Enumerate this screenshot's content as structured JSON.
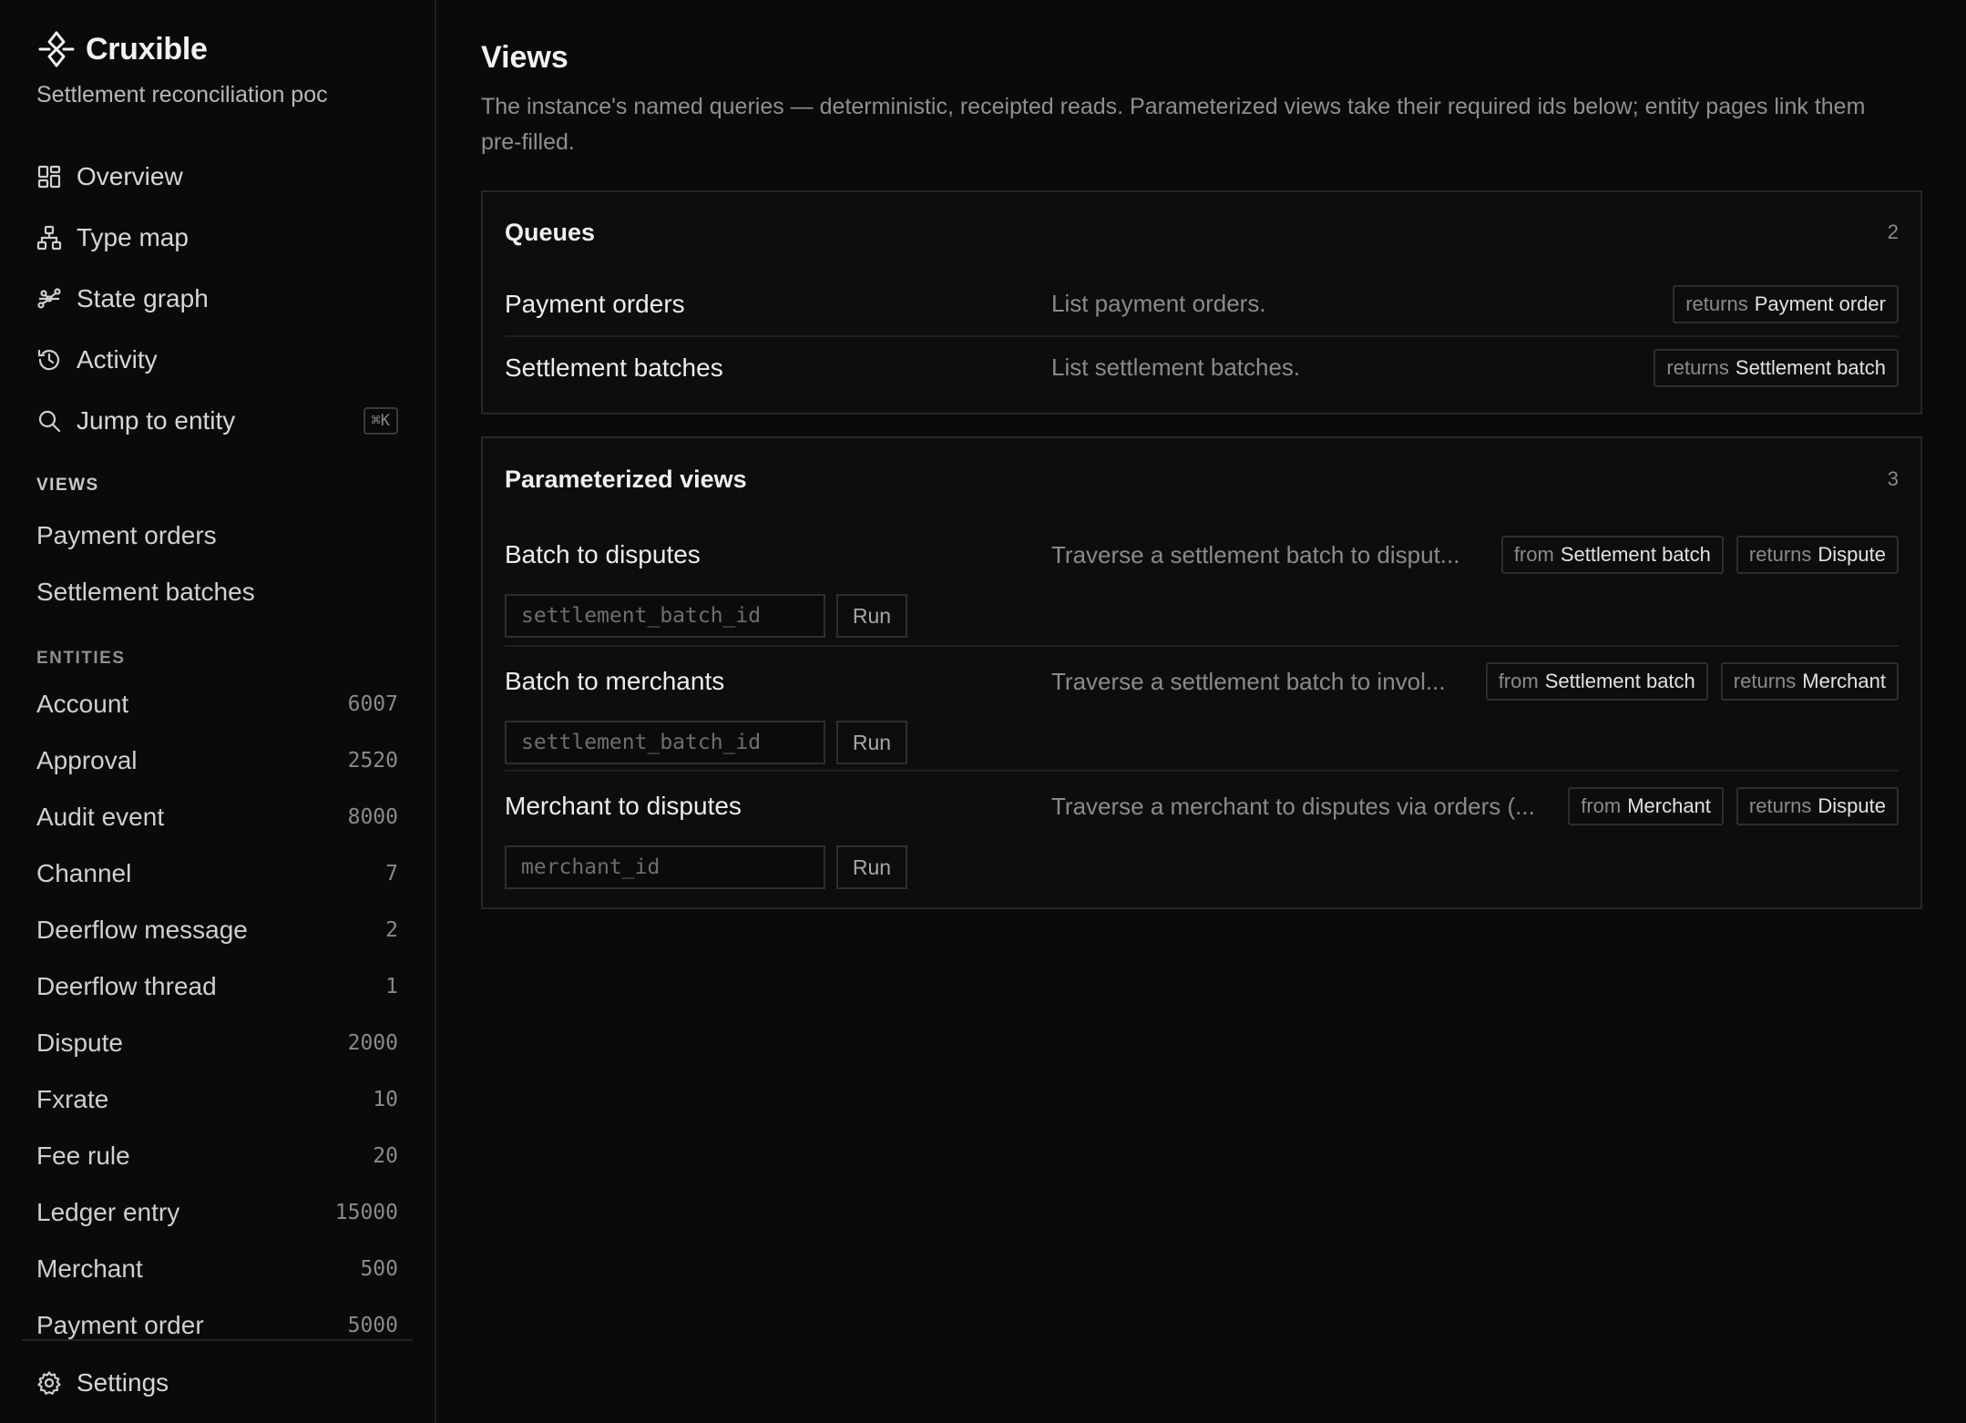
{
  "brand": {
    "name": "Cruxible",
    "subtitle": "Settlement reconciliation poc"
  },
  "nav": {
    "items": [
      {
        "label": "Overview",
        "icon": "grid-icon"
      },
      {
        "label": "Type map",
        "icon": "hierarchy-icon"
      },
      {
        "label": "State graph",
        "icon": "graph-icon"
      },
      {
        "label": "Activity",
        "icon": "history-icon"
      },
      {
        "label": "Jump to entity",
        "icon": "search-icon",
        "shortcut": "⌘K"
      }
    ]
  },
  "views_section": {
    "label": "VIEWS",
    "items": [
      "Payment orders",
      "Settlement batches"
    ]
  },
  "entities_section": {
    "label": "ENTITIES",
    "items": [
      {
        "name": "Account",
        "count": "6007"
      },
      {
        "name": "Approval",
        "count": "2520"
      },
      {
        "name": "Audit event",
        "count": "8000"
      },
      {
        "name": "Channel",
        "count": "7"
      },
      {
        "name": "Deerflow message",
        "count": "2"
      },
      {
        "name": "Deerflow thread",
        "count": "1"
      },
      {
        "name": "Dispute",
        "count": "2000"
      },
      {
        "name": "Fxrate",
        "count": "10"
      },
      {
        "name": "Fee rule",
        "count": "20"
      },
      {
        "name": "Ledger entry",
        "count": "15000"
      },
      {
        "name": "Merchant",
        "count": "500"
      },
      {
        "name": "Payment order",
        "count": "5000"
      }
    ]
  },
  "settings": {
    "label": "Settings",
    "icon": "gear-icon"
  },
  "page": {
    "title": "Views",
    "description": "The instance's named queries — deterministic, receipted reads. Parameterized views take their required ids below; entity pages link them pre-filled."
  },
  "queues": {
    "title": "Queues",
    "count": "2",
    "rows": [
      {
        "name": "Payment orders",
        "desc": "List payment orders.",
        "returns_key": "returns",
        "returns": "Payment order"
      },
      {
        "name": "Settlement batches",
        "desc": "List settlement batches.",
        "returns_key": "returns",
        "returns": "Settlement batch"
      }
    ]
  },
  "parameterized": {
    "title": "Parameterized views",
    "count": "3",
    "run_label": "Run",
    "rows": [
      {
        "name": "Batch to disputes",
        "desc": "Traverse a settlement batch to disput...",
        "from_key": "from",
        "from": "Settlement batch",
        "returns_key": "returns",
        "returns": "Dispute",
        "placeholder": "settlement_batch_id",
        "value": ""
      },
      {
        "name": "Batch to merchants",
        "desc": "Traverse a settlement batch to invol...",
        "from_key": "from",
        "from": "Settlement batch",
        "returns_key": "returns",
        "returns": "Merchant",
        "placeholder": "settlement_batch_id",
        "value": ""
      },
      {
        "name": "Merchant to disputes",
        "desc": "Traverse a merchant to disputes via orders (...",
        "from_key": "from",
        "from": "Merchant",
        "returns_key": "returns",
        "returns": "Dispute",
        "placeholder": "merchant_id",
        "value": ""
      }
    ]
  }
}
